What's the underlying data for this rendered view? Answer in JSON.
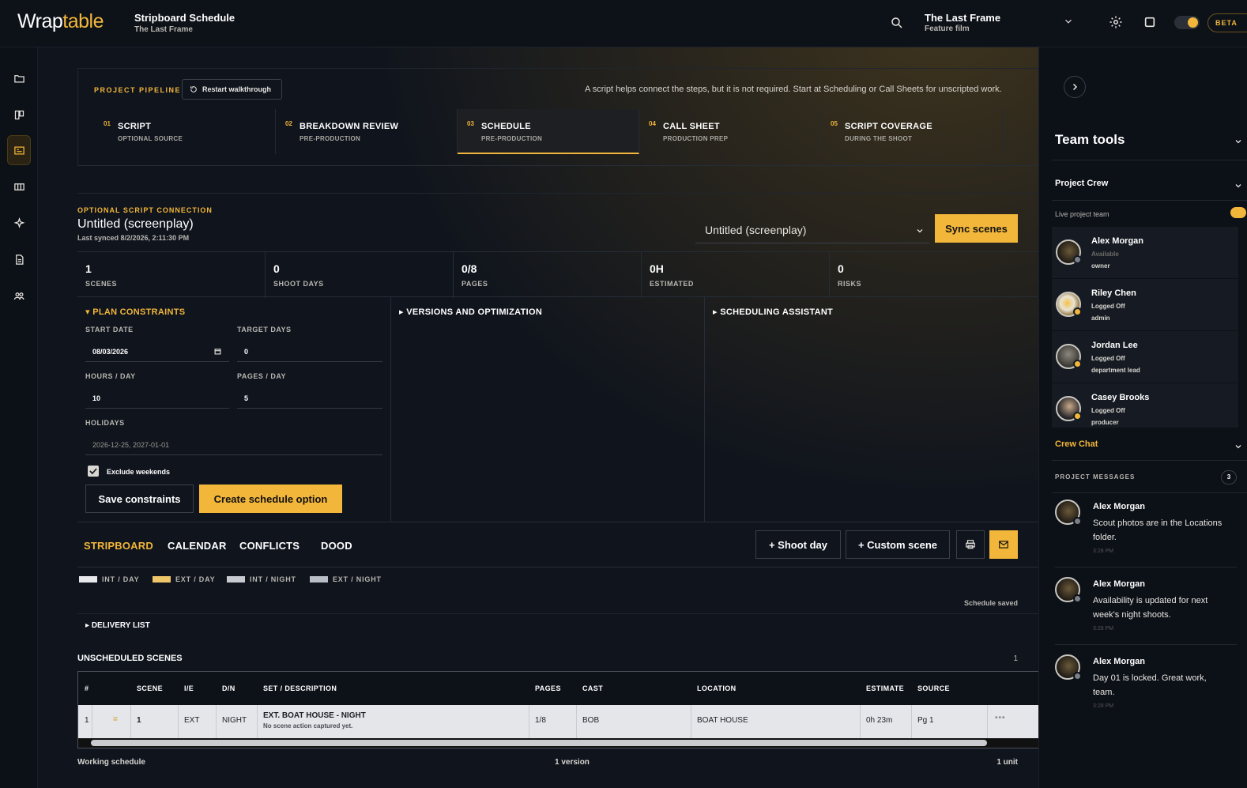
{
  "colors": {
    "accent": "#f2b63a",
    "bg": "#0f141d",
    "panel": "#0c1017"
  },
  "app": {
    "logo_a": "Wrap",
    "logo_b": "table",
    "title": "Stripboard Schedule",
    "subtitle": "The Last Frame"
  },
  "topbar": {
    "project_title": "The Last Frame",
    "project_sub": "Feature film",
    "beta": "BETA"
  },
  "rail": [
    "folder-icon",
    "board-icon",
    "schedule-icon",
    "callsheet-icon",
    "sparkle-icon",
    "document-icon",
    "team-icon"
  ],
  "pipeline": {
    "label": "PROJECT PIPELINE",
    "restart": "Restart walkthrough",
    "note": "A script helps connect the steps, but it is not required. Start at Scheduling or Call Sheets for unscripted work.",
    "steps": [
      {
        "num": "01",
        "title": "SCRIPT",
        "sub": "OPTIONAL SOURCE"
      },
      {
        "num": "02",
        "title": "BREAKDOWN REVIEW",
        "sub": "PRE-PRODUCTION"
      },
      {
        "num": "03",
        "title": "SCHEDULE",
        "sub": "PRE-PRODUCTION"
      },
      {
        "num": "04",
        "title": "CALL SHEET",
        "sub": "PRODUCTION PREP"
      },
      {
        "num": "05",
        "title": "SCRIPT COVERAGE",
        "sub": "DURING THE SHOOT"
      }
    ]
  },
  "script_conn": {
    "label": "OPTIONAL SCRIPT CONNECTION",
    "title": "Untitled (screenplay)",
    "synced": "Last synced 8/2/2026, 2:11:30 PM",
    "select_value": "Untitled (screenplay)",
    "sync_btn": "Sync scenes"
  },
  "stats": [
    {
      "value": "1",
      "label": "SCENES"
    },
    {
      "value": "0",
      "label": "SHOOT DAYS"
    },
    {
      "value": "0/8",
      "label": "PAGES"
    },
    {
      "value": "0H",
      "label": "ESTIMATED"
    },
    {
      "value": "0",
      "label": "RISKS"
    }
  ],
  "constraints": {
    "heading": "PLAN CONSTRAINTS",
    "start_date_label": "START DATE",
    "start_date": "08/03/2026",
    "target_days_label": "TARGET DAYS",
    "target_days": "0",
    "hours_label": "HOURS / DAY",
    "hours": "10",
    "pages_label": "PAGES / DAY",
    "pages": "5",
    "holidays_label": "HOLIDAYS",
    "holidays": "2026-12-25, 2027-01-01",
    "exclude_weekends": "Exclude weekends",
    "save_btn": "Save constraints",
    "create_btn": "Create schedule option"
  },
  "versions_heading": "VERSIONS AND OPTIMIZATION",
  "assistant_heading": "SCHEDULING ASSISTANT",
  "tabs": [
    "STRIPBOARD",
    "CALENDAR",
    "CONFLICTS",
    "DOOD"
  ],
  "toolbar": {
    "shoot_day": "+ Shoot day",
    "custom_scene": "+ Custom scene"
  },
  "legend": [
    {
      "label": "INT / DAY",
      "color": "#e8e9ec"
    },
    {
      "label": "EXT / DAY",
      "color": "#f0c66a"
    },
    {
      "label": "INT / NIGHT",
      "color": "#c7cad1"
    },
    {
      "label": "EXT / NIGHT",
      "color": "#b9bdc5"
    }
  ],
  "schedule_saved": "Schedule saved",
  "delivery": "DELIVERY LIST",
  "unscheduled": {
    "title": "UNSCHEDULED SCENES",
    "count": "1",
    "headers": [
      "#",
      "SCENE",
      "I/E",
      "D/N",
      "SET / DESCRIPTION",
      "PAGES",
      "CAST",
      "LOCATION",
      "ESTIMATE",
      "SOURCE"
    ],
    "row": {
      "idx": "1",
      "scene": "1",
      "ie": "EXT",
      "dn": "NIGHT",
      "set": "EXT. BOAT HOUSE - NIGHT",
      "desc": "No scene action captured yet.",
      "pages": "1/8",
      "cast": "BOB",
      "location": "BOAT HOUSE",
      "estimate": "0h 23m",
      "source": "Pg 1"
    }
  },
  "footer": {
    "left": "Working schedule",
    "mid": "1 version",
    "right": "1 unit"
  },
  "team": {
    "title": "Team tools",
    "crew_heading": "Project Crew",
    "live": "Live project team",
    "members": [
      {
        "name": "Alex Morgan",
        "status": "Available",
        "role": "owner"
      },
      {
        "name": "Riley Chen",
        "status": "Logged Off",
        "role": "admin"
      },
      {
        "name": "Jordan Lee",
        "status": "Logged Off",
        "role": "department lead"
      },
      {
        "name": "Casey Brooks",
        "status": "Logged Off",
        "role": "producer"
      }
    ],
    "chat": "Crew Chat",
    "pm_label": "PROJECT MESSAGES",
    "pm_count": "3",
    "messages": [
      {
        "name": "Alex Morgan",
        "text": "Scout photos are in the Locations folder.",
        "time": "3:28 PM"
      },
      {
        "name": "Alex Morgan",
        "text": "Availability is updated for next week's night shoots.",
        "time": "3:28 PM"
      },
      {
        "name": "Alex Morgan",
        "text": "Day 01 is locked. Great work, team.",
        "time": "3:28 PM"
      }
    ]
  }
}
